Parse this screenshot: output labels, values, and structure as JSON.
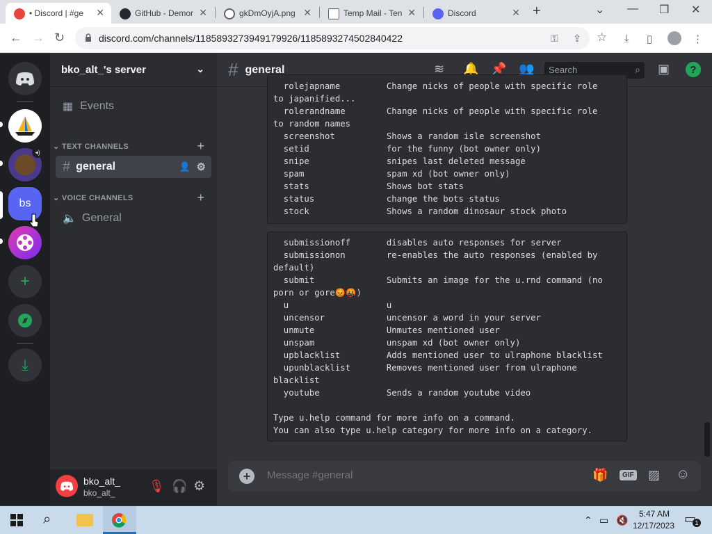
{
  "browser": {
    "tabs": [
      {
        "title": "• Discord | #ge",
        "icon": "discord-icon"
      },
      {
        "title": "GitHub - Demor",
        "icon": "github-icon"
      },
      {
        "title": "gkDmOyjA.png",
        "icon": "globe-icon"
      },
      {
        "title": "Temp Mail - Ten",
        "icon": "mail-icon"
      },
      {
        "title": "Discord",
        "icon": "discord-icon"
      }
    ],
    "url": "discord.com/channels/1185893273949179926/1185893274502840422"
  },
  "servers": {
    "selected_initials": "bs"
  },
  "channel_sidebar": {
    "server_name": "bko_alt_'s server",
    "events_label": "Events",
    "text_category": "TEXT CHANNELS",
    "text_channel": "general",
    "voice_category": "VOICE CHANNELS",
    "voice_channel": "General"
  },
  "user": {
    "display_name": "bko_alt_",
    "username": "bko_alt_"
  },
  "chat": {
    "channel": "general",
    "search_placeholder": "Search",
    "message_placeholder": "Message #general",
    "block1_lines": [
      "  rolejapname         Change nicks of people with specific role",
      "to japanified...",
      "  rolerandname        Change nicks of people with specific role",
      "to random names",
      "  screenshot          Shows a random isle screenshot",
      "  setid               for the funny (bot owner only)",
      "  snipe               snipes last deleted message",
      "  spam                spam xd (bot owner only)",
      "  stats               Shows bot stats",
      "  status              change the bots status",
      "  stock               Shows a random dinosaur stock photo"
    ],
    "block2_lines": [
      "  submissionoff       disables auto responses for server",
      "  submissionon        re-enables the auto responses (enabled by",
      "default)",
      "  submit              Submits an image for the u.rnd command (no",
      "porn or gore😡🤬)",
      "  u                   u",
      "  uncensor            uncensor a word in your server",
      "  unmute              Unmutes mentioned user",
      "  unspam              unspam xd (bot owner only)",
      "  upblacklist         Adds mentioned user to ulraphone blacklist",
      "  upunblacklist       Removes mentioned user from ulraphone",
      "blacklist",
      "  youtube             Sends a random youtube video",
      "",
      "Type u.help command for more info on a command.",
      "You can also type u.help category for more info on a category."
    ]
  },
  "taskbar": {
    "time": "5:47 AM",
    "date": "12/17/2023",
    "notification_count": "1"
  },
  "colors": {
    "blurple": "#5865f2",
    "green": "#23a559",
    "red_mute": "#f23f42"
  }
}
